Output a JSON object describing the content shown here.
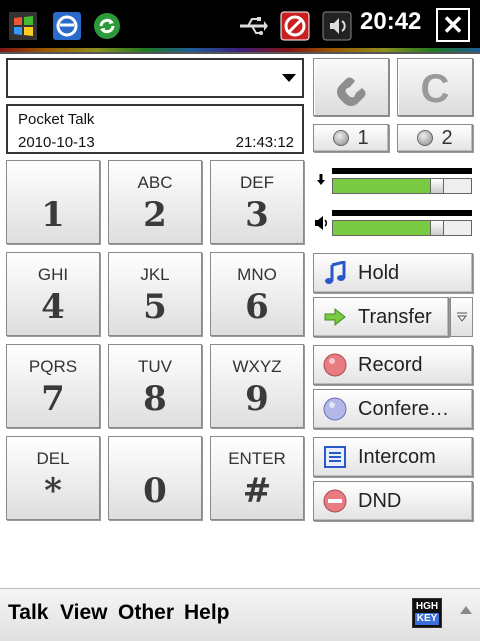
{
  "status_bar": {
    "clock": "20:42",
    "close_label": "✕"
  },
  "call": {
    "number_value": "",
    "info_app": "Pocket Talk",
    "info_date": "2010-10-13",
    "info_time": "21:43:12",
    "clear_label": "C",
    "line1_label": "1",
    "line2_label": "2"
  },
  "keypad": [
    {
      "letters": "",
      "digit": "1"
    },
    {
      "letters": "ABC",
      "digit": "2"
    },
    {
      "letters": "DEF",
      "digit": "3"
    },
    {
      "letters": "GHI",
      "digit": "4"
    },
    {
      "letters": "JKL",
      "digit": "5"
    },
    {
      "letters": "MNO",
      "digit": "6"
    },
    {
      "letters": "PQRS",
      "digit": "7"
    },
    {
      "letters": "TUV",
      "digit": "8"
    },
    {
      "letters": "WXYZ",
      "digit": "9"
    },
    {
      "letters": "DEL",
      "digit": "*"
    },
    {
      "letters": "",
      "digit": "0"
    },
    {
      "letters": "ENTER",
      "digit": "#"
    }
  ],
  "volume": {
    "mic_level": 0.72,
    "speaker_level": 0.72
  },
  "actions": {
    "hold": "Hold",
    "transfer": "Transfer",
    "record": "Record",
    "conference": "Confere…",
    "intercom": "Intercom",
    "dnd": "DND"
  },
  "menu": {
    "talk": "Talk",
    "view": "View",
    "other": "Other",
    "help": "Help",
    "sip_top": "HGH",
    "sip_bottom": "KEY"
  },
  "colors": {
    "green_fill": "#7ac943",
    "record_red": "#e87a82",
    "conference_blue": "#b4b8e8"
  }
}
